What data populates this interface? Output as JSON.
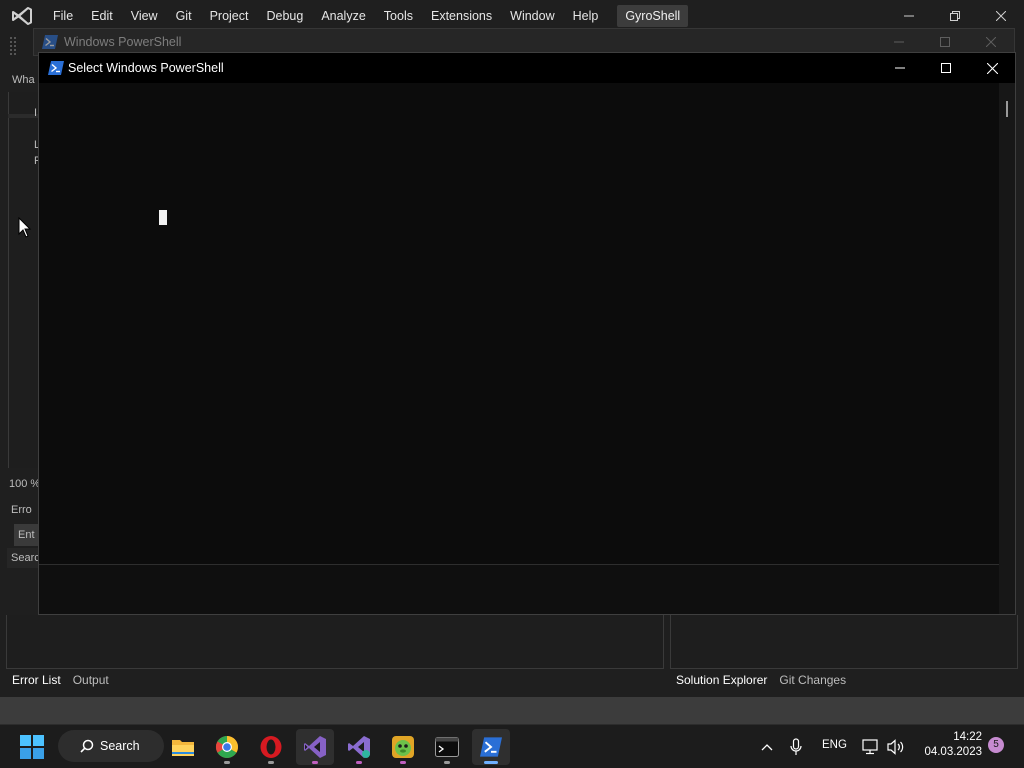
{
  "vs": {
    "menu": [
      "File",
      "Edit",
      "View",
      "Git",
      "Project",
      "Debug",
      "Analyze",
      "Tools",
      "Extensions",
      "Window",
      "Help"
    ],
    "solution_name": "GyroShell",
    "left_slivers": {
      "doc_tab": "Wha",
      "line_1": "I",
      "line_2": "L",
      "line_3": "P",
      "zoom": "100 %",
      "error_list_header": "Erro",
      "entire_solution": "Ent",
      "search": "Searc"
    },
    "bottom_tabs": [
      "Error List",
      "Output"
    ],
    "right_tabs": [
      "Solution Explorer",
      "Git Changes"
    ],
    "accent_color": "#4e5a8a"
  },
  "powershell_back": {
    "title": "Windows PowerShell"
  },
  "powershell_front": {
    "title": "Select Windows PowerShell",
    "background": "#0c0c0c"
  },
  "taskbar": {
    "search_label": "Search",
    "apps": [
      "file-explorer-icon",
      "chrome-icon",
      "opera-icon",
      "visual-studio-icon",
      "visual-studio-preview-icon",
      "game-app-icon",
      "terminal-icon",
      "powershell-icon"
    ],
    "language": "ENG",
    "time": "14:22",
    "date": "04.03.2023",
    "notification_count": "5"
  }
}
